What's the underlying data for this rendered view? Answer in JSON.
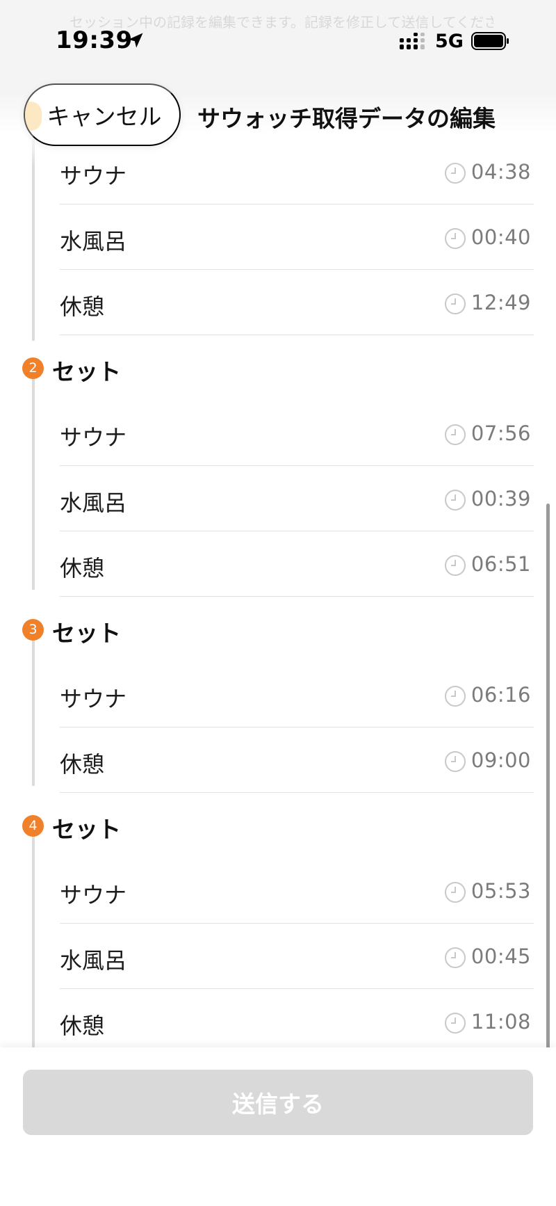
{
  "status_bar": {
    "time": "19:39",
    "network": "5G",
    "icons": [
      "location-arrow-icon",
      "signal-bars-icon",
      "battery-icon"
    ]
  },
  "header": {
    "ghost_text": "セッション中の記録を編集できます。記録を修正して送信してください",
    "cancel_label": "キャンセル",
    "title": "サウォッチ取得データの編集"
  },
  "sets": [
    {
      "number": "",
      "title": "",
      "rows": [
        {
          "label": "サウナ",
          "time": "04:38"
        },
        {
          "label": "水風呂",
          "time": "00:40"
        },
        {
          "label": "休憩",
          "time": "12:49"
        }
      ]
    },
    {
      "number": "2",
      "title": "セット",
      "rows": [
        {
          "label": "サウナ",
          "time": "07:56"
        },
        {
          "label": "水風呂",
          "time": "00:39"
        },
        {
          "label": "休憩",
          "time": "06:51"
        }
      ]
    },
    {
      "number": "3",
      "title": "セット",
      "rows": [
        {
          "label": "サウナ",
          "time": "06:16"
        },
        {
          "label": "休憩",
          "time": "09:00"
        }
      ]
    },
    {
      "number": "4",
      "title": "セット",
      "rows": [
        {
          "label": "サウナ",
          "time": "05:53"
        },
        {
          "label": "水風呂",
          "time": "00:45"
        },
        {
          "label": "休憩",
          "time": "11:08"
        }
      ]
    }
  ],
  "footer": {
    "submit_label": "送信する"
  },
  "colors": {
    "badge": "#f0802a",
    "submit_disabled": "#d9d9d9",
    "time_text": "#7b7b7b"
  }
}
